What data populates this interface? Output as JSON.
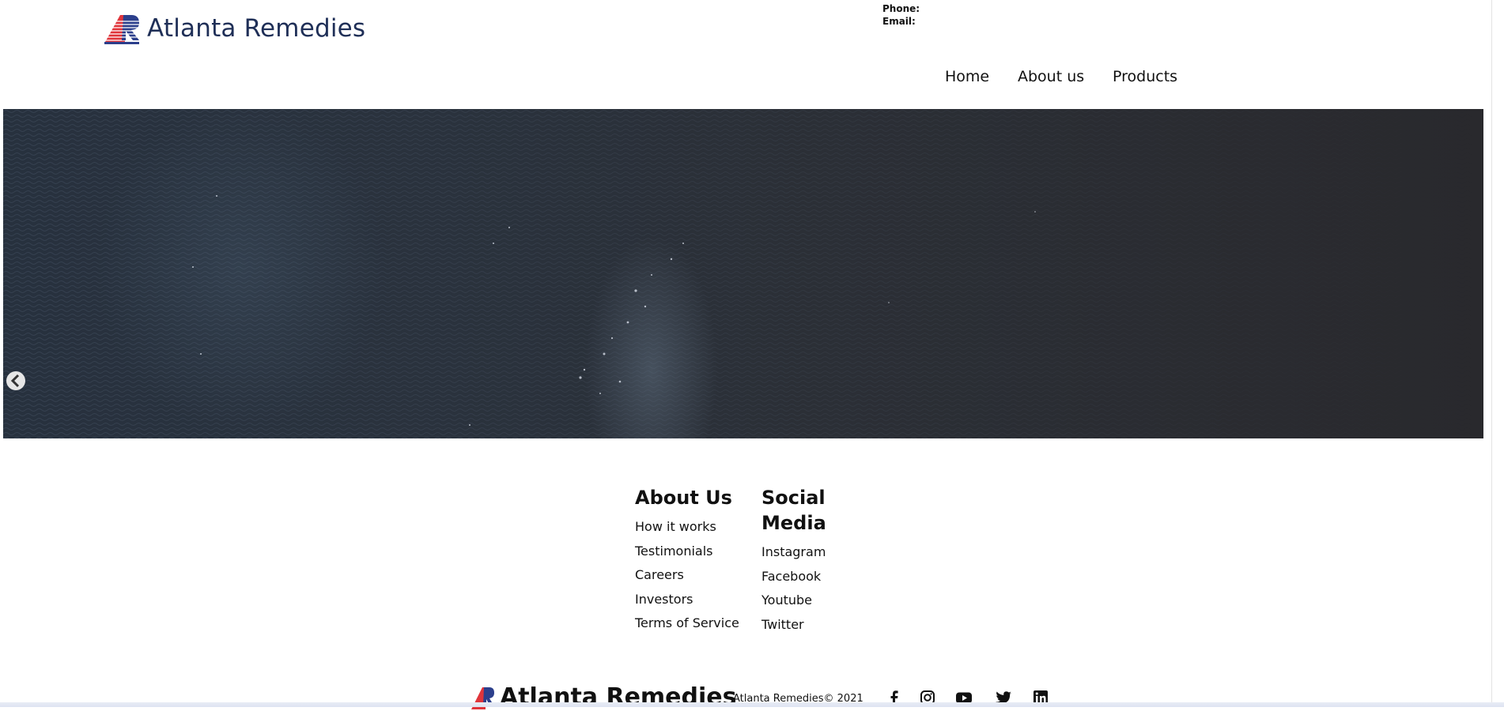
{
  "header": {
    "brand_name": "Atlanta Remedies",
    "logo_icon": "atlanta-remedies-logo",
    "contact": {
      "phone_label": "Phone:",
      "email_label": "Email:"
    }
  },
  "nav": {
    "items": [
      {
        "label": "Home"
      },
      {
        "label": "About us"
      },
      {
        "label": "Products"
      }
    ]
  },
  "hero": {
    "image": "dark ocean water aerial view",
    "prev_icon": "chevron-left-icon",
    "next_icon": "chevron-right-icon"
  },
  "footer": {
    "about": {
      "heading": "About Us",
      "links": [
        "How it works",
        "Testimonials",
        "Careers",
        "Investors",
        "Terms of Service"
      ]
    },
    "social": {
      "heading_line1": "Social",
      "heading_line2": "Media",
      "links": [
        "Instagram",
        "Facebook",
        "Youtube",
        "Twitter"
      ]
    },
    "brand_name": "Atlanta Remedies",
    "copyright": "Atlanta Remedies© 2021",
    "social_icons": [
      "facebook-icon",
      "instagram-icon",
      "youtube-icon",
      "twitter-icon",
      "linkedin-icon"
    ]
  },
  "colors": {
    "brand_text": "#1f2f57",
    "logo_red": "#e0353b",
    "logo_blue": "#2c3f8c",
    "hero_bg": "#2a2f38"
  }
}
